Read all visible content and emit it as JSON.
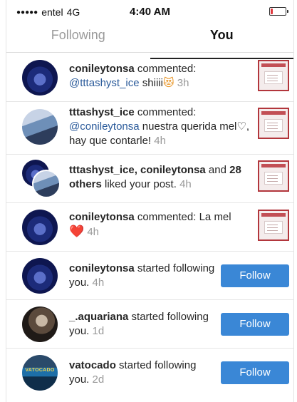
{
  "status_bar": {
    "carrier": "entel",
    "network": "4G",
    "time": "4:40 AM",
    "signal_icon": "signal-dots-icon",
    "battery_icon": "battery-low-icon"
  },
  "tabs": [
    {
      "label": "Following",
      "active": false
    },
    {
      "label": "You",
      "active": true
    }
  ],
  "notifications": [
    {
      "user": "conileytonsa",
      "action": " commented:",
      "mention": "@tttashyst_ice",
      "text": " shiiii",
      "emoji": "😻",
      "time": "3h",
      "type": "comment"
    },
    {
      "user": "tttashyst_ice",
      "action": " commented:",
      "mention": "@conileytonsa",
      "text": " nuestra querida mel♡, hay que contarle!",
      "time": "4h",
      "type": "comment"
    },
    {
      "users": "tttashyst_ice, conileytonsa",
      "connector": " and ",
      "others": "28 others",
      "text": " liked your post.",
      "time": "4h",
      "type": "like"
    },
    {
      "user": "conileytonsa",
      "action": " commented:",
      "text": " La mel",
      "emoji": "❤️",
      "time": "4h",
      "type": "comment"
    },
    {
      "user": "conileytonsa",
      "text": " started following you.",
      "time": "4h",
      "button": "Follow",
      "type": "follow"
    },
    {
      "user": "_.aquariana",
      "text": " started following you.",
      "time": "1d",
      "button": "Follow",
      "type": "follow"
    },
    {
      "user": "vatocado",
      "avatar_text": "VATOCADO",
      "text": " started following you.",
      "time": "2d",
      "button": "Follow",
      "type": "follow"
    }
  ],
  "colors": {
    "accent_blue": "#3a87d6",
    "mention_blue": "#2a5a9a",
    "heart_red": "#e0245e",
    "battery_red": "#e0383e"
  }
}
